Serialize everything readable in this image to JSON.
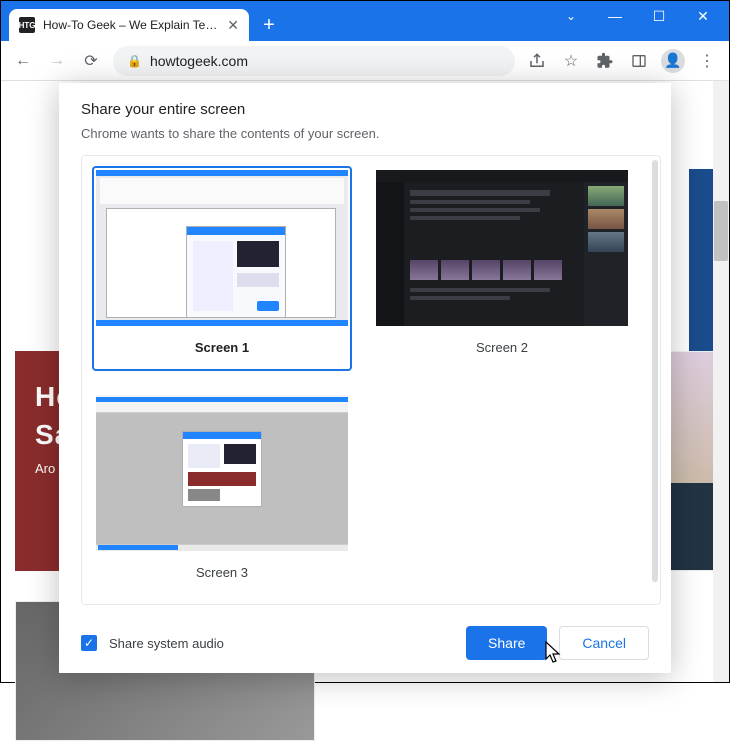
{
  "window": {
    "tab_title": "How-To Geek – We Explain Techn",
    "favicon_text": "HTG"
  },
  "toolbar": {
    "url": "howtogeek.com"
  },
  "page": {
    "headline_line1": "Ho",
    "headline_line2": "Sa",
    "byline": "Aro"
  },
  "dialog": {
    "title": "Share your entire screen",
    "subtitle": "Chrome wants to share the contents of your screen.",
    "screens": [
      {
        "label": "Screen 1",
        "selected": true
      },
      {
        "label": "Screen 2",
        "selected": false
      },
      {
        "label": "Screen 3",
        "selected": false
      }
    ],
    "audio_checkbox": {
      "checked": true,
      "label": "Share system audio"
    },
    "share_button": "Share",
    "cancel_button": "Cancel"
  }
}
